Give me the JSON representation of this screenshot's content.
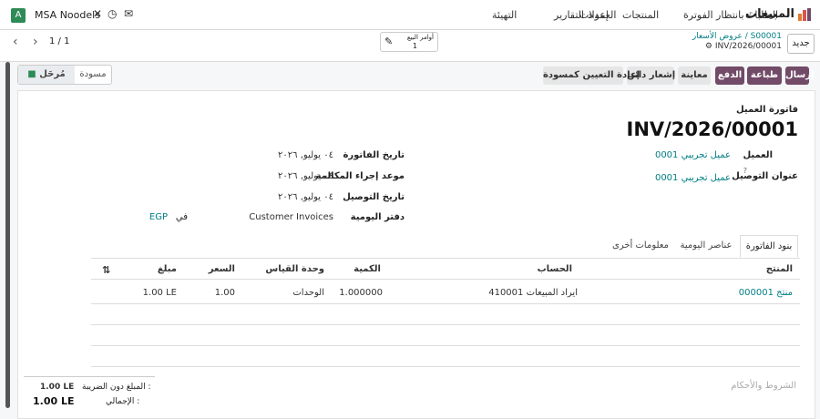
{
  "navbar": {
    "avatar_letter": "A",
    "company": "MSA Noodels",
    "brand": "المبيعات",
    "menu": [
      "الطلبات",
      "بانتظار الفوترة",
      "المنتجات",
      "العمولات",
      "إعداد التقارير",
      "التهيئة"
    ]
  },
  "control": {
    "new_label": "جديد",
    "breadcrumb_parent": "عروض الأسعار / S00001",
    "breadcrumb_current": "INV/2026/00001",
    "smart_button_label": "أوامر البيع",
    "smart_button_count": "1",
    "pager": "1 / 1"
  },
  "actions": {
    "send": "إرسال",
    "print": "طباعة",
    "payment": "الدفع",
    "preview": "معاينة",
    "credit_note": "إشعار دائن",
    "reset_draft": "إعادة التعيين كمسودة"
  },
  "status": {
    "posted": "مُرحَل",
    "draft": "مسودة"
  },
  "invoice": {
    "type_label": "فاتورة العميل",
    "number": "INV/2026/00001",
    "customer_label": "العميل",
    "customer_value": "عميل تجريبي 0001",
    "delivery_label": "عنوان التوصيل",
    "delivery_help": "?",
    "delivery_value": "عميل تجريبي 0001",
    "invoice_date_label": "تاريخ الفاتورة",
    "invoice_date_value": "٠٤ يوليو, ٢٠٢٦",
    "due_date_label": "موعد إجراء المكالمة",
    "due_date_value": "٠٤ يوليو, ٢٠٢٦",
    "delivery_date_label": "تاريخ التوصيل",
    "delivery_date_value": "٠٤ يوليو, ٢٠٢٦",
    "journal_label": "دفتر اليومية",
    "journal_value": "Customer Invoices",
    "currency_prefix": "في",
    "currency": "EGP"
  },
  "tabs": [
    "بنود الفاتورة",
    "عناصر اليومية",
    "معلومات أخرى"
  ],
  "table": {
    "headers": {
      "product": "المنتج",
      "account": "الحساب",
      "quantity": "الكمية",
      "uom": "وحدة القياس",
      "price": "السعر",
      "amount": "مبلغ"
    },
    "rows": [
      {
        "product": "منتج 000001",
        "account": "410001 ايراد المبيعات",
        "quantity": "1.000000",
        "uom": "الوحدات",
        "price": "1.00",
        "amount": "1.00 LE"
      }
    ]
  },
  "footer": {
    "terms_placeholder": "الشروط والأحكام",
    "untaxed_label": "المبلغ دون الضريبة :",
    "untaxed_value": "1.00 LE",
    "total_label": "الإجمالي :",
    "total_value": "1.00 LE"
  },
  "colors": {
    "primary": "#714b67",
    "link": "#017e84",
    "avatar": "#2e8b57"
  }
}
